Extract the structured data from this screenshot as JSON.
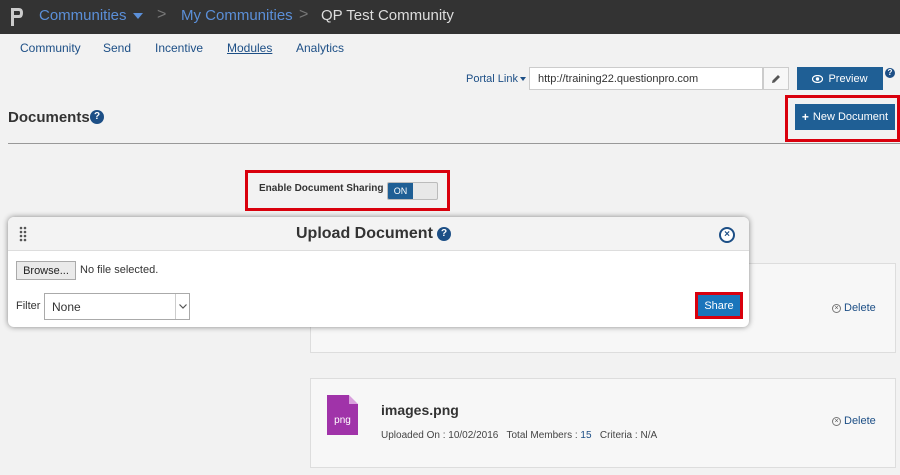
{
  "topbar": {
    "breadcrumbs": [
      "Communities",
      "My Communities",
      "QP Test Community"
    ],
    "separator": ">"
  },
  "subnav": {
    "items": [
      {
        "label": "Community",
        "active": false
      },
      {
        "label": "Send",
        "active": false
      },
      {
        "label": "Incentive",
        "active": false
      },
      {
        "label": "Modules",
        "active": true
      },
      {
        "label": "Analytics",
        "active": false
      }
    ]
  },
  "portal": {
    "label": "Portal Link",
    "url": "http://training22.questionpro.com",
    "preview_label": "Preview",
    "help": "?"
  },
  "page": {
    "title": "Documents",
    "help": "?",
    "new_document_label": "New Document"
  },
  "sharing": {
    "label": "Enable Document Sharing",
    "toggle_state": "ON"
  },
  "documents": [
    {
      "name": "",
      "ext": "",
      "uploaded_on": "",
      "total_members": "",
      "criteria": "",
      "delete_label": "Delete"
    },
    {
      "name": "images.png",
      "ext": "png",
      "uploaded_on_label": "Uploaded On :",
      "uploaded_on": "10/02/2016",
      "total_members_label": "Total Members :",
      "total_members": "15",
      "criteria_label": "Criteria :",
      "criteria": "N/A",
      "delete_label": "Delete"
    }
  ],
  "modal": {
    "title": "Upload Document",
    "help": "?",
    "close": "×",
    "browse_label": "Browse...",
    "no_file_text": "No file selected.",
    "filter_label": "Filter",
    "filter_value": "None",
    "share_label": "Share"
  },
  "colors": {
    "topbar_bg": "#333333",
    "link_blue": "#5b8fd8",
    "primary_btn": "#1f5f95",
    "highlight_red": "#d9000d",
    "file_icon": "#a033a9"
  }
}
